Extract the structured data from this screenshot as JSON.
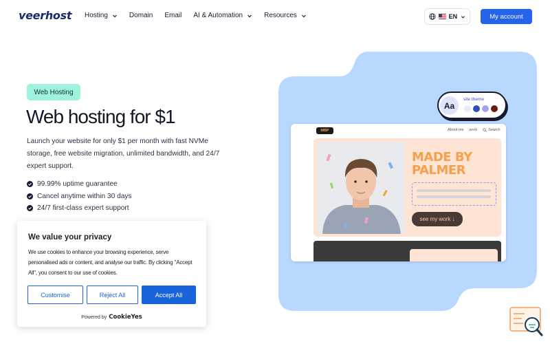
{
  "brand": {
    "logo": "veerhost"
  },
  "nav": {
    "items": [
      {
        "label": "Hosting",
        "has_dropdown": true
      },
      {
        "label": "Domain",
        "has_dropdown": false
      },
      {
        "label": "Email",
        "has_dropdown": false
      },
      {
        "label": "AI & Automation",
        "has_dropdown": true
      },
      {
        "label": "Resources",
        "has_dropdown": true
      }
    ],
    "language": {
      "code": "EN",
      "icon": "globe-icon",
      "flag": "us-flag"
    },
    "account_button": "My account"
  },
  "hero": {
    "badge": "Web Hosting",
    "title": "Web hosting for $1",
    "description": "Launch your website for only $1 per month with fast NVMe storage, free website migration, unlimited bandwidth, and 24/7 expert support.",
    "features": [
      "99.99% uptime guarantee",
      "Cancel anytime within 30 days",
      "24/7 first-class expert support"
    ]
  },
  "illustration": {
    "theme_widget": {
      "aa": "Aa",
      "label": "site theme",
      "swatches": [
        "#e6e9fb",
        "#2f4fb8",
        "#a6a2f2",
        "#6b1b14"
      ]
    },
    "site_logo": "MBP",
    "site_nav": [
      "About me",
      "work",
      "Search"
    ],
    "headline_lines": [
      "MADE BY",
      "PALMER"
    ],
    "cta": "see my work ↓",
    "colors": {
      "background": "#b9d8ff",
      "accent": "#f6a04d",
      "panel": "#fde4d5"
    }
  },
  "cookie_banner": {
    "title": "We value your privacy",
    "text": "We use cookies to enhance your browsing experience, serve personalised ads or content, and analyse our traffic. By clicking \"Accept All\", you consent to our use of cookies.",
    "buttons": {
      "customise": "Customise",
      "reject": "Reject All",
      "accept": "Accept All"
    },
    "powered_by": "Powered by",
    "powered_brand": "CookieYes"
  },
  "colors": {
    "primary": "#2563eb",
    "cookie_primary": "#1863dc",
    "badge_bg": "#9ff3dc",
    "logo": "#1d2a6b"
  }
}
